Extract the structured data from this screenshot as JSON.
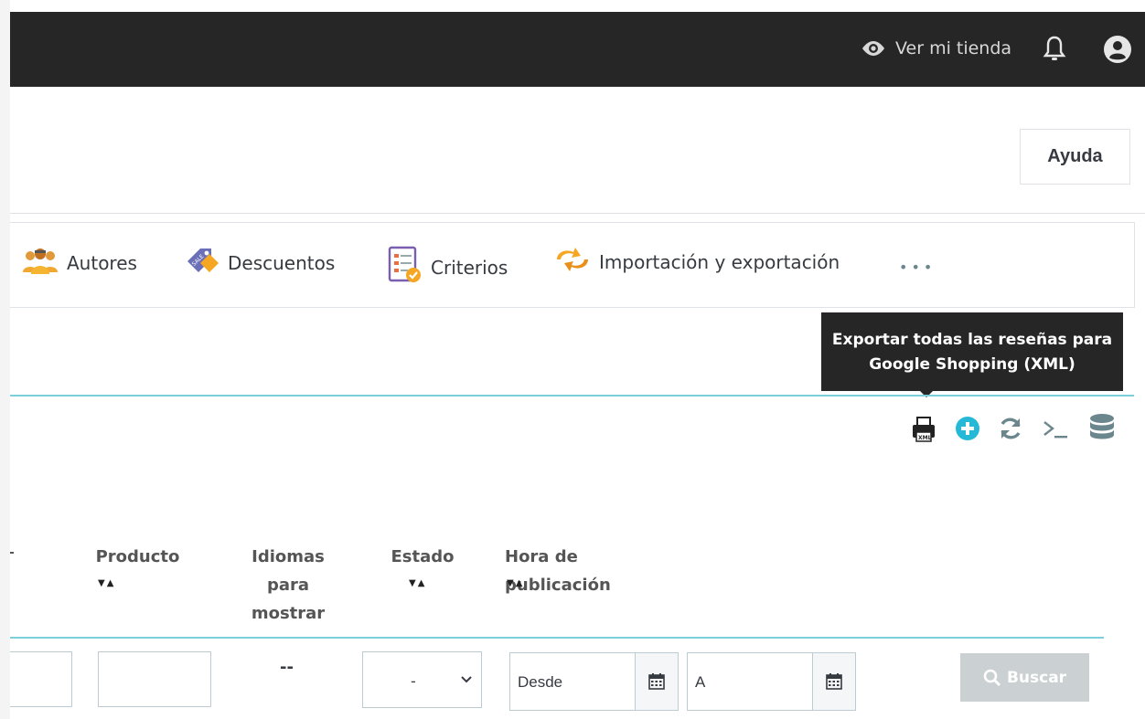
{
  "topbar": {
    "view_shop_label": "Ver mi tienda"
  },
  "header": {
    "help_label": "Ayuda"
  },
  "tabs": [
    {
      "label": "Autores",
      "icon": "authors-icon"
    },
    {
      "label": "Descuentos",
      "icon": "discount-tag-icon"
    },
    {
      "label": "Criterios",
      "icon": "criteria-icon"
    },
    {
      "label": "Importación y exportación",
      "icon": "import-export-icon"
    }
  ],
  "tabs_more": "•••",
  "tooltip": {
    "line1": "Exportar todas las reseñas para",
    "line2": "Google Shopping (XML)"
  },
  "toolbar": {
    "icons": [
      "xml-export-icon",
      "add-icon",
      "refresh-icon",
      "terminal-icon",
      "database-icon"
    ],
    "xml_badge": "XML"
  },
  "table": {
    "headers": {
      "producto": "Producto",
      "idiomas_line1": "Idiomas",
      "idiomas_line2": "para",
      "idiomas_line3": "mostrar",
      "estado": "Estado",
      "hora": "Hora de publicación"
    },
    "sort_glyph": "▼▲",
    "filters": {
      "idiomas_placeholder": "--",
      "estado_value": "-",
      "desde_placeholder": "Desde",
      "hasta_placeholder": "A",
      "search_label": "Buscar"
    }
  },
  "colors": {
    "topbar": "#262626",
    "accent_line": "#7cd0dc",
    "add_icon": "#25b9d7",
    "search_disabled": "#cbd0d2"
  }
}
